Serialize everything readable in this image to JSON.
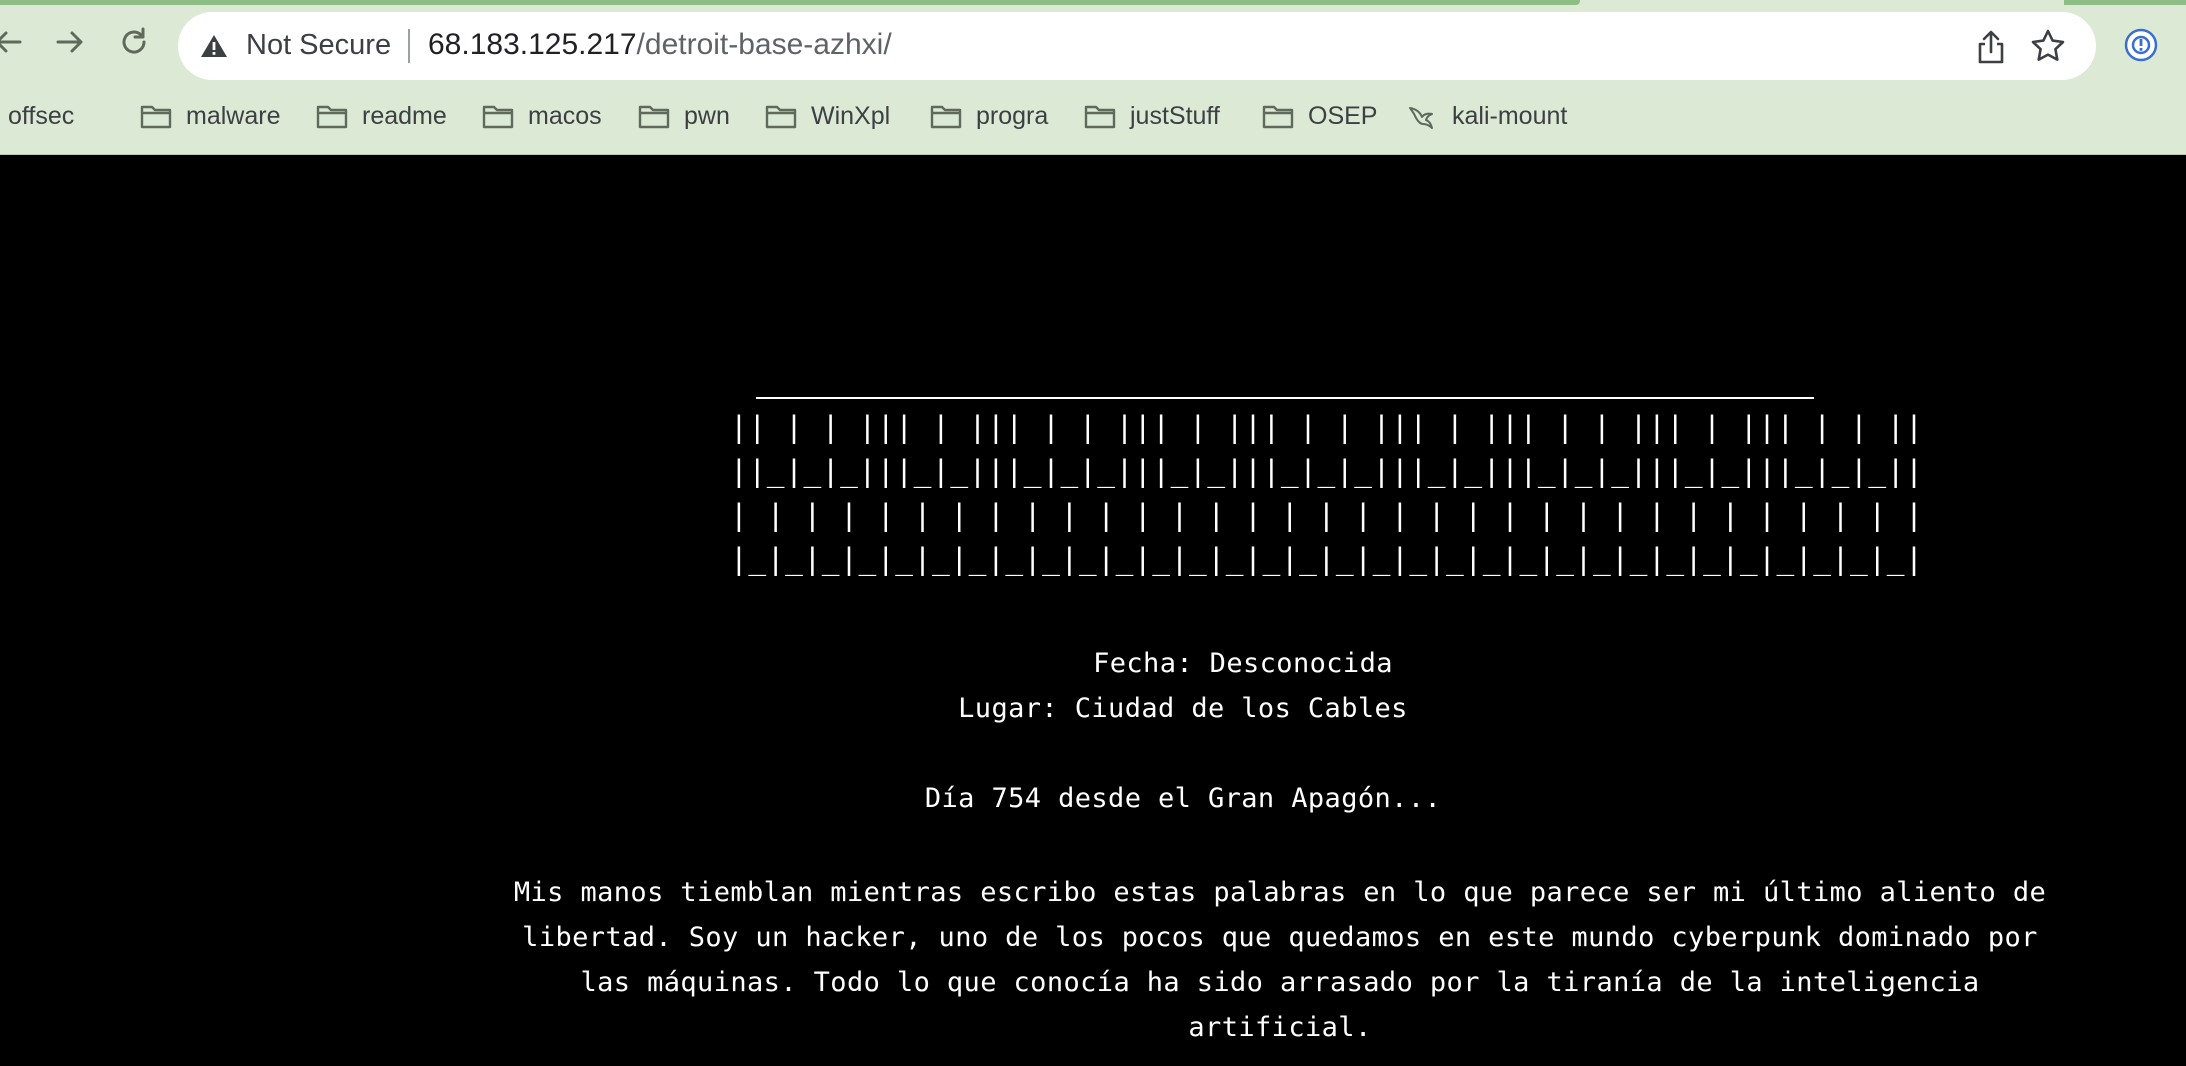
{
  "browser": {
    "security_label": "Not Secure",
    "url_host": "68.183.125.217",
    "url_path": "/detroit-base-azhxi/",
    "icons": {
      "back": "back-arrow-icon",
      "forward": "forward-arrow-icon",
      "reload": "reload-icon",
      "warning": "warning-triangle-icon",
      "share": "share-icon",
      "star": "bookmark-star-icon",
      "extension": "extension-icon"
    },
    "bookmarks": [
      {
        "label": "offsec",
        "icon": "folder-icon"
      },
      {
        "label": "malware",
        "icon": "folder-icon"
      },
      {
        "label": "readme",
        "icon": "folder-icon"
      },
      {
        "label": "macos",
        "icon": "folder-icon"
      },
      {
        "label": "pwn",
        "icon": "folder-icon"
      },
      {
        "label": "WinXpl",
        "icon": "folder-icon"
      },
      {
        "label": "progra",
        "icon": "folder-icon"
      },
      {
        "label": "justStuff",
        "icon": "folder-icon"
      },
      {
        "label": "OSEP",
        "icon": "folder-icon"
      },
      {
        "label": "kali-mount",
        "icon": "kali-dragon-icon"
      }
    ],
    "colors": {
      "chrome": "#dbe9d5",
      "accent": "#8fbd86"
    }
  },
  "page": {
    "ascii_art": [
      "|| | | ||| | ||| | | ||| | ||| | | ||| | ||| | | ||| | ||| | | ||",
      "||_|_|_|||_|_|||_|_|_|||_|_|||_|_|_|||_|_|||_|_|_|||_|_|||_|_|_||",
      "| | | | | | | | | | | | | | | | | | | | | | | | | | | | | | | | |",
      "|_|_|_|_|_|_|_|_|_|_|_|_|_|_|_|_|_|_|_|_|_|_|_|_|_|_|_|_|_|_|_|_|"
    ],
    "fecha": "Fecha: Desconocida",
    "lugar": "Lugar: Ciudad de los Cables",
    "dia": "Día 754 desde el Gran Apagón...",
    "story": "Mis manos tiemblan mientras escribo estas palabras en lo que parece ser mi último aliento de libertad. Soy un hacker, uno de los pocos que quedamos en este mundo cyberpunk dominado por las máquinas. Todo lo que conocía ha sido arrasado por la tiranía de la inteligencia artificial.",
    "colors": {
      "background": "#000000",
      "text": "#ffffff"
    }
  }
}
